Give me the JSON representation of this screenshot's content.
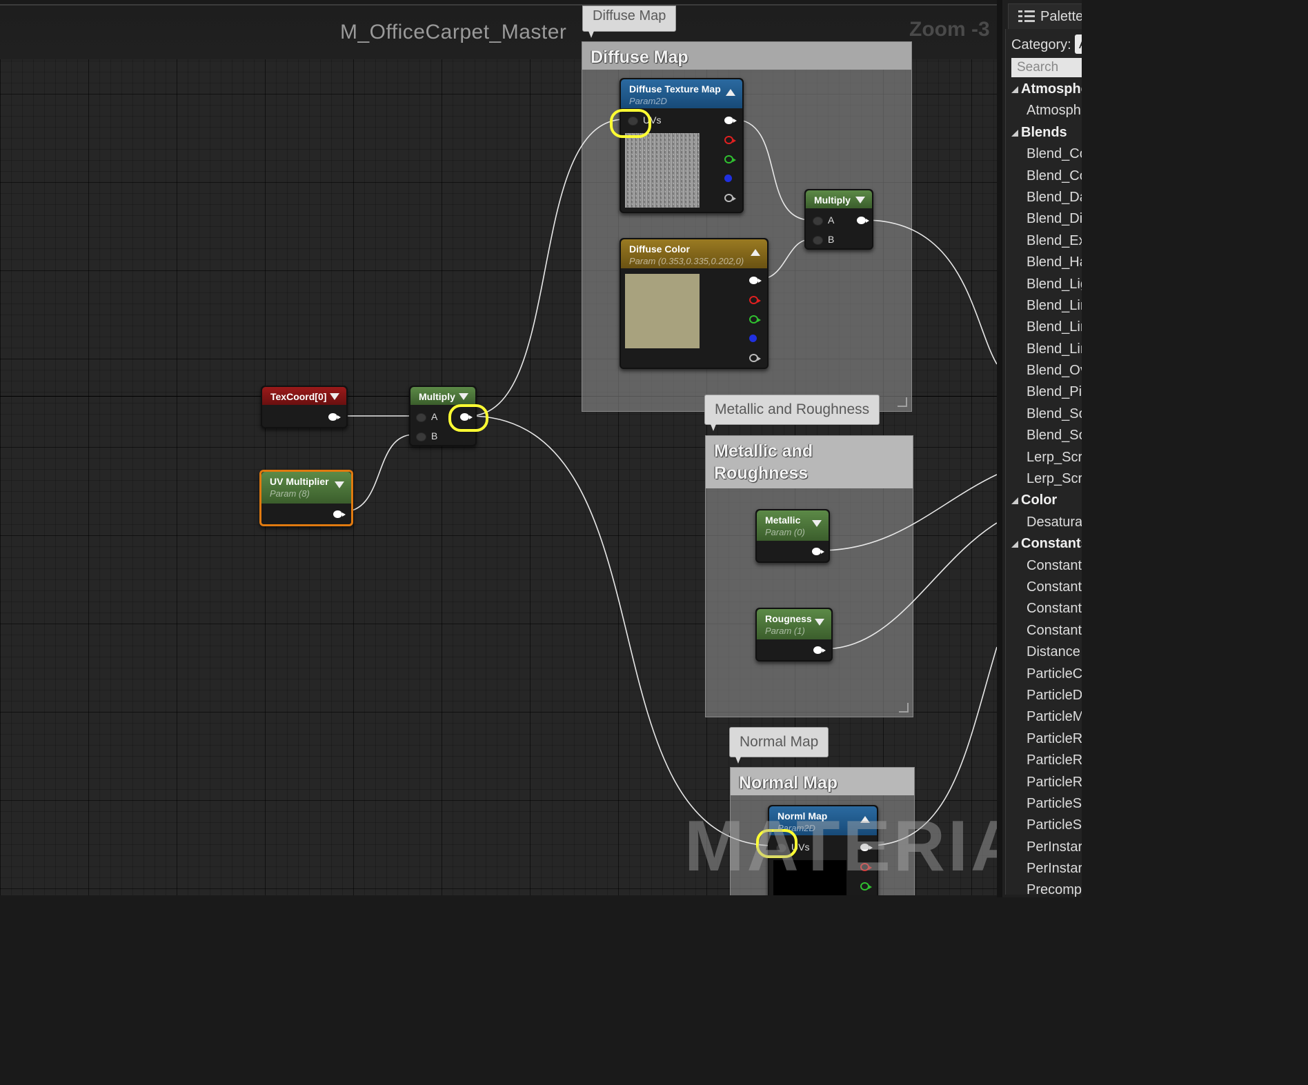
{
  "graph": {
    "title": "M_OfficeCarpet_Master",
    "zoom": "Zoom -3",
    "watermark": "MATERIAL"
  },
  "comments": {
    "diffuse": {
      "bubble": "Diffuse Map",
      "title": "Diffuse Map"
    },
    "metallic": {
      "bubble": "Metallic and Roughness",
      "title_line1": "Metallic and",
      "title_line2": "Roughness"
    },
    "normal": {
      "bubble": "Normal Map",
      "title": "Normal Map"
    }
  },
  "nodes": {
    "texcoord": {
      "title": "TexCoord[0]"
    },
    "uv_multiplier": {
      "title": "UV Multiplier",
      "subtitle": "Param (8)"
    },
    "multiply_uv": {
      "title": "Multiply",
      "pin_a": "A",
      "pin_b": "B"
    },
    "diffuse_texture": {
      "title": "Diffuse Texture Map",
      "subtitle": "Param2D",
      "pin_uvs": "UVs"
    },
    "diffuse_color": {
      "title": "Diffuse Color",
      "subtitle": "Param (0.353,0.335,0.202,0)",
      "swatch": "#a8a27e"
    },
    "multiply_color": {
      "title": "Multiply",
      "pin_a": "A",
      "pin_b": "B"
    },
    "metallic": {
      "title": "Metallic",
      "subtitle": "Param (0)"
    },
    "roughness": {
      "title": "Rougness",
      "subtitle": "Param (1)"
    },
    "normal_map": {
      "title": "Norml Map",
      "subtitle": "Param2D",
      "pin_uvs": "UVs"
    }
  },
  "palette": {
    "tab_label": "Palette",
    "category_label": "Category:",
    "category_value": "A",
    "search_placeholder": "Search",
    "items": [
      {
        "label": "Atmosphe",
        "kind": "category"
      },
      {
        "label": "Atmosph",
        "kind": "item"
      },
      {
        "label": "Blends",
        "kind": "category"
      },
      {
        "label": "Blend_Co",
        "kind": "item"
      },
      {
        "label": "Blend_Co",
        "kind": "item"
      },
      {
        "label": "Blend_Da",
        "kind": "item"
      },
      {
        "label": "Blend_Di",
        "kind": "item"
      },
      {
        "label": "Blend_Ex",
        "kind": "item"
      },
      {
        "label": "Blend_Ha",
        "kind": "item"
      },
      {
        "label": "Blend_Lig",
        "kind": "item"
      },
      {
        "label": "Blend_Lir",
        "kind": "item"
      },
      {
        "label": "Blend_Lir",
        "kind": "item"
      },
      {
        "label": "Blend_Lir",
        "kind": "item"
      },
      {
        "label": "Blend_Ov",
        "kind": "item"
      },
      {
        "label": "Blend_Pi",
        "kind": "item"
      },
      {
        "label": "Blend_So",
        "kind": "item"
      },
      {
        "label": "Blend_So",
        "kind": "item"
      },
      {
        "label": "Lerp_Scr",
        "kind": "item"
      },
      {
        "label": "Lerp_Scr",
        "kind": "item"
      },
      {
        "label": "Color",
        "kind": "category"
      },
      {
        "label": "Desatura",
        "kind": "item"
      },
      {
        "label": "Constants",
        "kind": "category"
      },
      {
        "label": "Constant",
        "kind": "item"
      },
      {
        "label": "Constant",
        "kind": "item"
      },
      {
        "label": "Constant",
        "kind": "item"
      },
      {
        "label": "Constant",
        "kind": "item"
      },
      {
        "label": "Distance",
        "kind": "item"
      },
      {
        "label": "ParticleC",
        "kind": "item"
      },
      {
        "label": "ParticleD",
        "kind": "item"
      },
      {
        "label": "ParticleM",
        "kind": "item"
      },
      {
        "label": "ParticleR",
        "kind": "item"
      },
      {
        "label": "ParticleR",
        "kind": "item"
      },
      {
        "label": "ParticleR",
        "kind": "item"
      },
      {
        "label": "ParticleS",
        "kind": "item"
      },
      {
        "label": "ParticleS",
        "kind": "item"
      },
      {
        "label": "PerInstar",
        "kind": "item"
      },
      {
        "label": "PerInstar",
        "kind": "item"
      },
      {
        "label": "Precomp",
        "kind": "item"
      }
    ]
  },
  "colors": {
    "highlight": "#ffff33",
    "pin_red": "#e02020",
    "pin_green": "#30c030",
    "pin_blue": "#2030e0",
    "pin_grey": "#bbbbbb"
  }
}
